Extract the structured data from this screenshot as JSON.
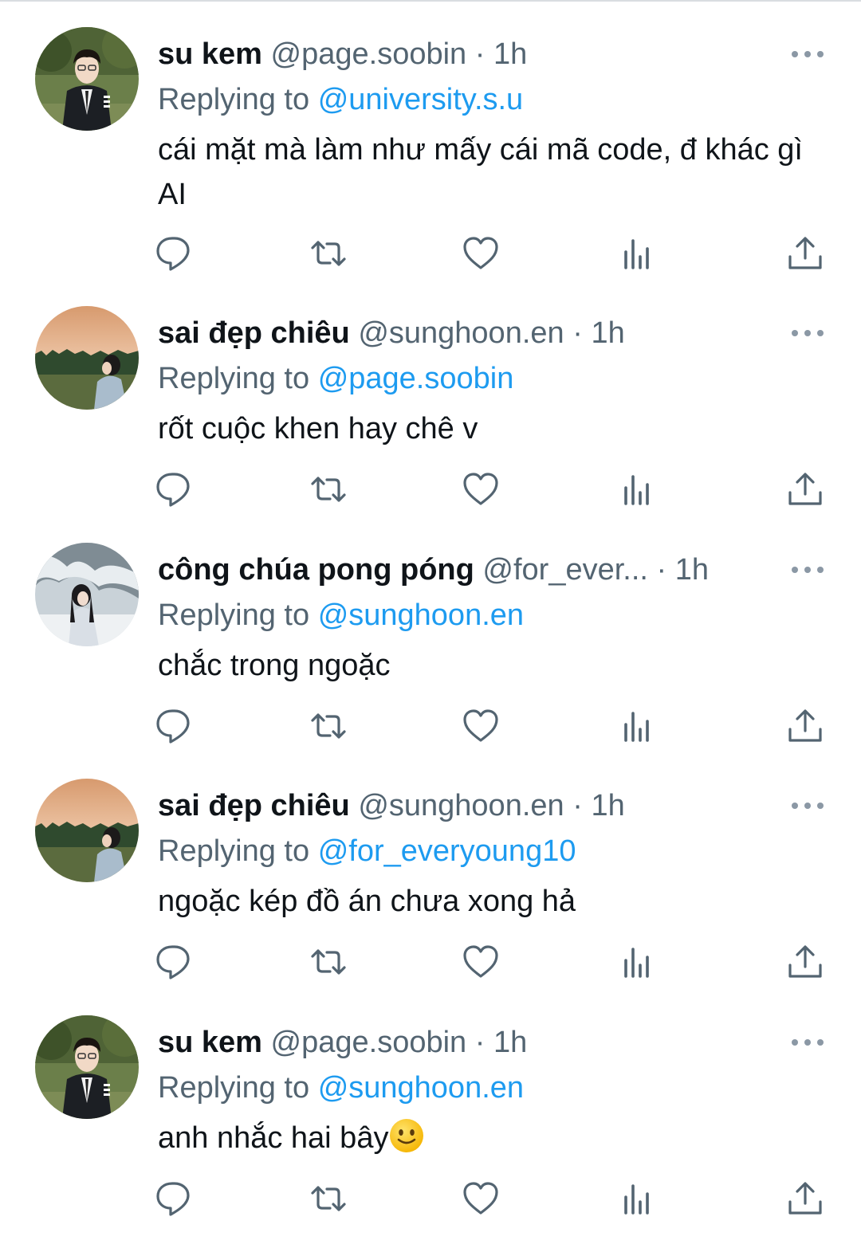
{
  "tweets": [
    {
      "name": "su kem",
      "handle": "@page.soobin",
      "sep": "·",
      "time": "1h",
      "replying_label": "Replying to",
      "replying_to": "@university.s.u",
      "text": "cái mặt mà làm như mấy cái mã code, đ khác gì AI",
      "avatar": "avatar-soobin"
    },
    {
      "name": "sai đẹp chiêu",
      "handle": "@sunghoon.en",
      "sep": "·",
      "time": "1h",
      "replying_label": "Replying to",
      "replying_to": "@page.soobin",
      "text": "rốt cuộc khen hay chê v",
      "avatar": "avatar-sunset"
    },
    {
      "name": "công chúa pong póng",
      "handle": "@for_ever...",
      "sep": "·",
      "time": "1h",
      "replying_label": "Replying to",
      "replying_to": "@sunghoon.en",
      "text": "chắc trong ngoặc",
      "avatar": "avatar-snow"
    },
    {
      "name": "sai đẹp chiêu",
      "handle": "@sunghoon.en",
      "sep": "·",
      "time": "1h",
      "replying_label": "Replying to",
      "replying_to": "@for_everyoung10",
      "text": "ngoặc kép đồ án chưa xong hả",
      "avatar": "avatar-sunset"
    },
    {
      "name": "su kem",
      "handle": "@page.soobin",
      "sep": "·",
      "time": "1h",
      "replying_label": "Replying to",
      "replying_to": "@sunghoon.en",
      "text": "anh nhắc hai bây",
      "text_emoji": "slightly-smiling-face",
      "avatar": "avatar-soobin"
    }
  ],
  "action_icons": [
    "reply-icon",
    "retweet-icon",
    "like-icon",
    "views-icon",
    "share-icon"
  ],
  "colors": {
    "text": "#0f1419",
    "secondary": "#536471",
    "mention": "#1d9bf0"
  }
}
